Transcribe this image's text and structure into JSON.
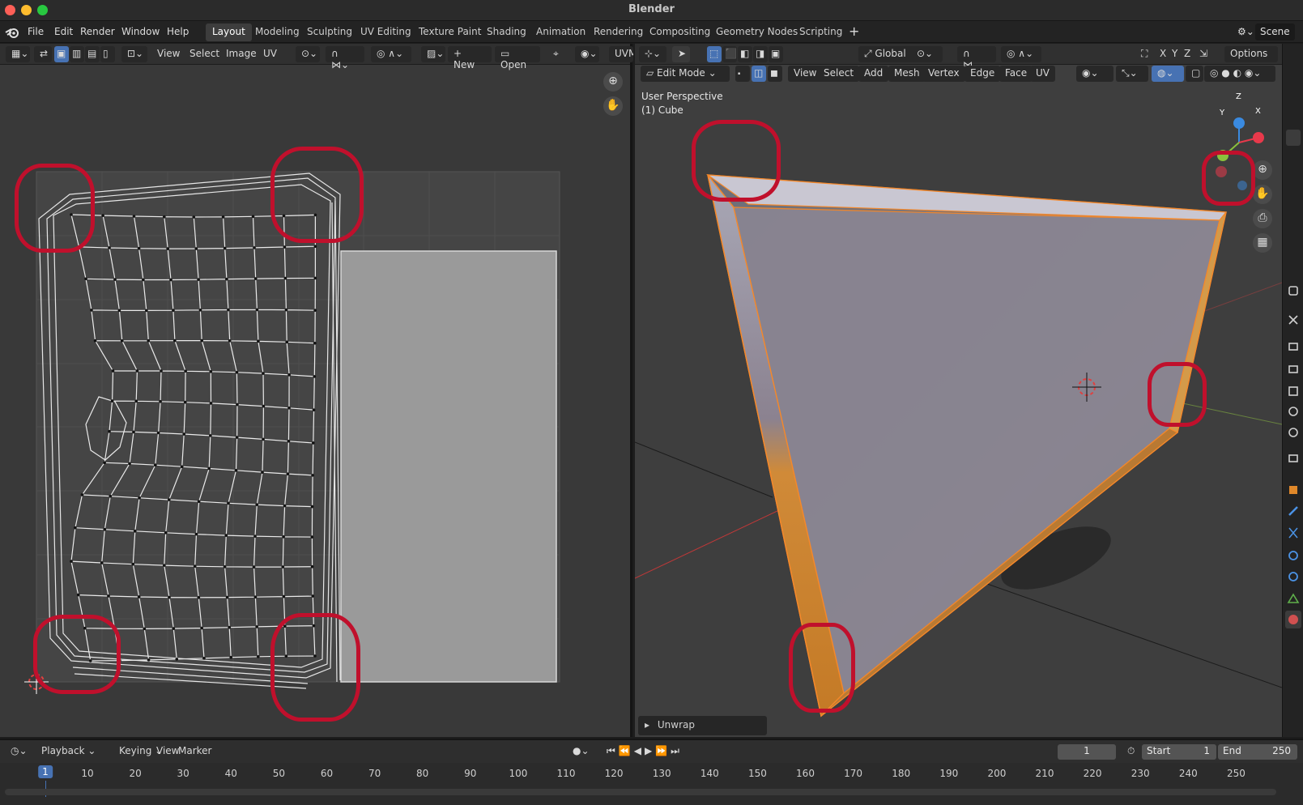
{
  "window": {
    "title": "Blender"
  },
  "menu": {
    "file": "File",
    "edit": "Edit",
    "render": "Render",
    "window": "Window",
    "help": "Help"
  },
  "workspaces": [
    "Layout",
    "Modeling",
    "Sculpting",
    "UV Editing",
    "Texture Paint",
    "Shading",
    "Animation",
    "Rendering",
    "Compositing",
    "Geometry Nodes",
    "Scripting"
  ],
  "scene": {
    "name": "Scene"
  },
  "uv_editor": {
    "menus": {
      "view": "View",
      "select": "Select",
      "image": "Image",
      "uv": "UV"
    },
    "new_label": "New",
    "open_label": "Open",
    "uv_map_label": "UVM"
  },
  "viewport": {
    "mode": "Edit Mode",
    "menus": {
      "view": "View",
      "select": "Select",
      "add": "Add",
      "mesh": "Mesh",
      "vertex": "Vertex",
      "edge": "Edge",
      "face": "Face",
      "uv": "UV"
    },
    "orientation": "Global",
    "options_label": "Options",
    "perspective_label": "User Perspective",
    "object_label": "(1) Cube",
    "gizmo_axes": {
      "x": "X",
      "y": "Y",
      "z": "Z"
    },
    "last_operator": "Unwrap"
  },
  "timeline": {
    "menus": {
      "playback": "Playback",
      "keying": "Keying",
      "view": "View",
      "marker": "Marker"
    },
    "current_frame": "1",
    "start_label": "Start",
    "start": "1",
    "end_label": "End",
    "end": "250",
    "ruler": [
      "10",
      "20",
      "30",
      "40",
      "50",
      "60",
      "70",
      "80",
      "90",
      "100",
      "110",
      "120",
      "130",
      "140",
      "150",
      "160",
      "170",
      "180",
      "190",
      "200",
      "210",
      "220",
      "230",
      "240",
      "250"
    ],
    "playhead": "1"
  },
  "colors": {
    "accent_blue": "#4772b3",
    "selection_orange": "#f5882a",
    "annotation_red": "#c0102c",
    "axis_x": "#e8394b",
    "axis_y": "#8ac13c",
    "axis_z": "#3a8ae0"
  }
}
